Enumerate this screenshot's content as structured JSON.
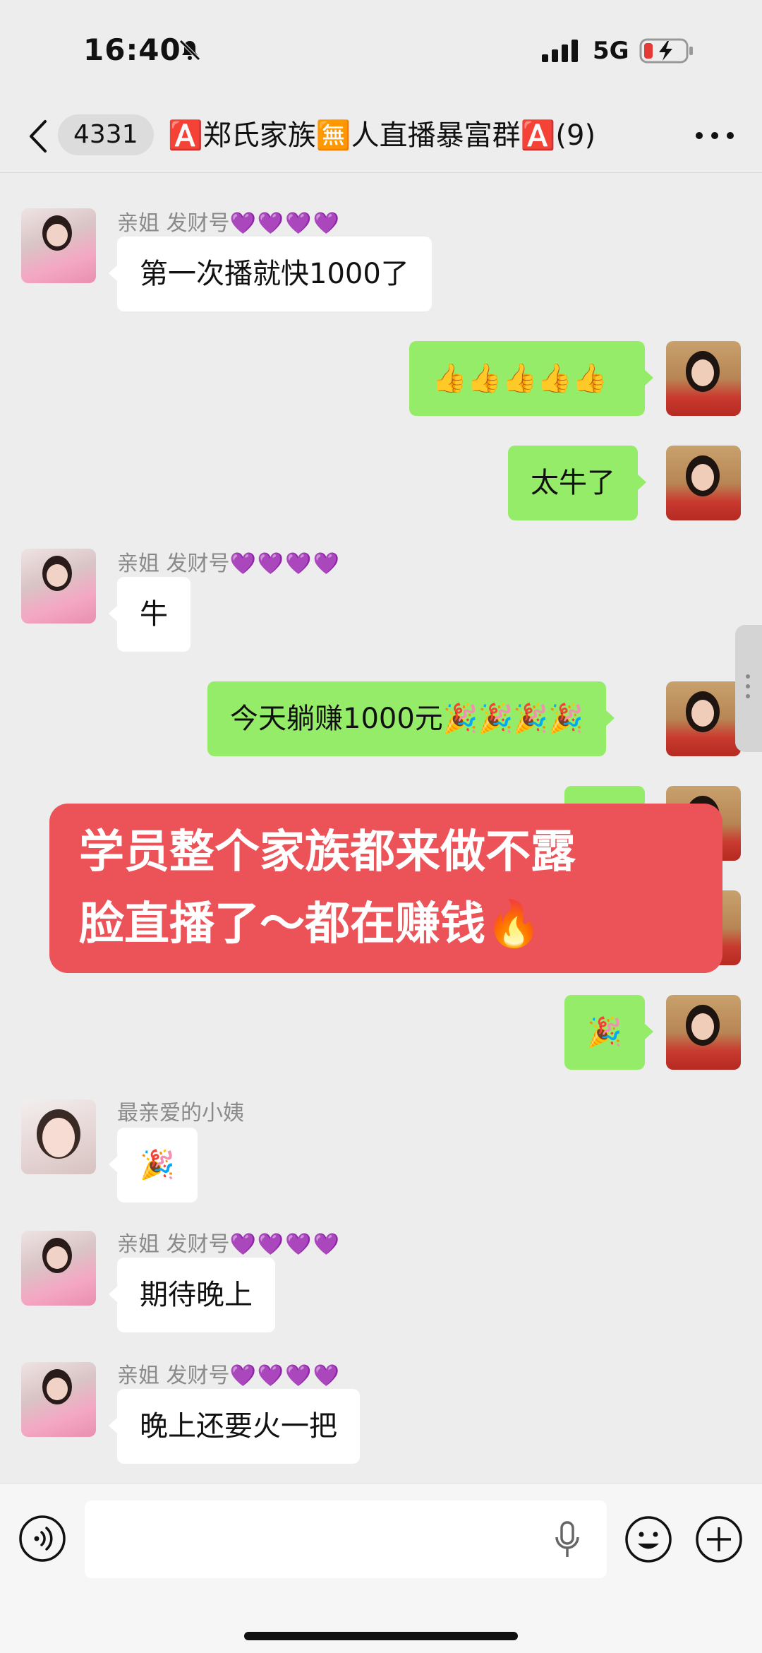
{
  "status_bar": {
    "time": "16:40",
    "network": "5G",
    "icons": [
      "bell-slash-icon",
      "signal-icon",
      "battery-charging-icon"
    ]
  },
  "nav": {
    "unread_count": "4331",
    "title": "🅰️郑氏家族🈚人直播暴富群🅰️(9)",
    "icons": [
      "chevron-left-icon",
      "more-icon"
    ]
  },
  "messages": [
    {
      "side": "in",
      "sender": "亲姐 发财号",
      "hearts": "💜💜💜💜",
      "text": "第一次播就快1000了"
    },
    {
      "side": "out",
      "text": "👍👍👍👍👍"
    },
    {
      "side": "out",
      "text": "太牛了"
    },
    {
      "side": "in",
      "sender": "亲姐 发财号",
      "hearts": "💜💜💜💜",
      "text": "牛"
    },
    {
      "side": "out",
      "text": "今天躺赚1000元🎉🎉🎉🎉"
    },
    {
      "side": "out",
      "text": "🎉"
    },
    {
      "side": "in",
      "sender": "最亲爱的小姨",
      "hearts": "",
      "text": "🎉"
    },
    {
      "side": "in",
      "sender": "亲姐 发财号",
      "hearts": "💜💜💜💜",
      "text": "期待晚上"
    },
    {
      "side": "in",
      "sender": "亲姐 发财号",
      "hearts": "💜💜💜💜",
      "text": "晚上还要火一把"
    }
  ],
  "banner": {
    "line1": "学员整个家族都来做不露",
    "line2": "脸直播了～都在赚钱🔥"
  },
  "input_bar": {
    "icons": [
      "voice-icon",
      "microphone-icon",
      "emoji-icon",
      "plus-icon"
    ]
  },
  "colors": {
    "background": "#ededed",
    "bubble_out": "#95ec69",
    "bubble_in": "#ffffff",
    "banner": "#ec5358",
    "heart": "#9b3fe0"
  }
}
